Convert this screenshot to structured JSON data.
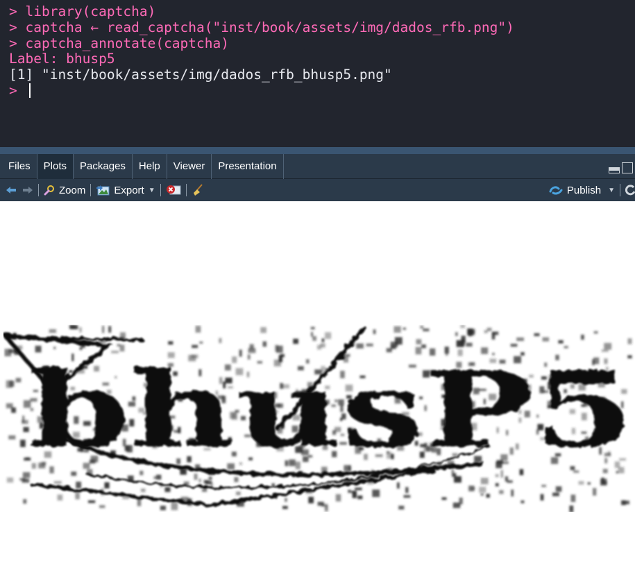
{
  "console": {
    "lines": [
      {
        "prompt": "> ",
        "text": "library(captcha)",
        "kind": "command"
      },
      {
        "prompt": "> ",
        "text": "captcha ← read_captcha(\"inst/book/assets/img/dados_rfb.png\")",
        "kind": "command"
      },
      {
        "prompt": "> ",
        "text": "captcha_annotate(captcha)",
        "kind": "command"
      },
      {
        "prompt": "",
        "text": "Label: bhusp5",
        "kind": "label"
      },
      {
        "prompt": "",
        "text": "[1] \"inst/book/assets/img/dados_rfb_bhusp5.png\"",
        "kind": "output"
      }
    ],
    "current_prompt": "> "
  },
  "tabs": [
    {
      "label": "Files",
      "active": false
    },
    {
      "label": "Plots",
      "active": true
    },
    {
      "label": "Packages",
      "active": false
    },
    {
      "label": "Help",
      "active": false
    },
    {
      "label": "Viewer",
      "active": false
    },
    {
      "label": "Presentation",
      "active": false
    }
  ],
  "toolbar": {
    "back_icon": "arrow-left-icon",
    "forward_icon": "arrow-right-icon",
    "zoom_label": "Zoom",
    "export_label": "Export",
    "remove_icon": "remove-plot-icon",
    "clear_icon": "broom-icon",
    "publish_label": "Publish",
    "refresh_icon": "refresh-icon"
  },
  "plot": {
    "captcha_text": "bhusP5"
  },
  "colors": {
    "console_bg": "#22252e",
    "console_pink": "#ff6ab7",
    "console_text": "#e6e8ee",
    "pane_bg": "#2b3a4a",
    "accent_blue": "#4aa3df"
  }
}
